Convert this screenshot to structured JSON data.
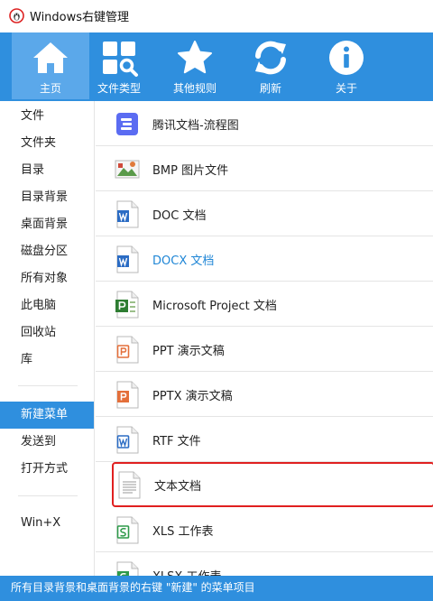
{
  "window": {
    "title": "Windows右键管理",
    "app_icon": "app-logo-icon"
  },
  "toolbar": {
    "buttons": [
      {
        "label": "主页",
        "icon": "home-icon",
        "active": true
      },
      {
        "label": "文件类型",
        "icon": "file-types-icon",
        "active": false
      },
      {
        "label": "其他规则",
        "icon": "star-icon",
        "active": false
      },
      {
        "label": "刷新",
        "icon": "refresh-icon",
        "active": false
      },
      {
        "label": "关于",
        "icon": "info-icon",
        "active": false
      }
    ]
  },
  "sidebar": {
    "items": [
      {
        "label": "文件"
      },
      {
        "label": "文件夹"
      },
      {
        "label": "目录"
      },
      {
        "label": "目录背景"
      },
      {
        "label": "桌面背景"
      },
      {
        "label": "磁盘分区"
      },
      {
        "label": "所有对象"
      },
      {
        "label": "此电脑"
      },
      {
        "label": "回收站"
      },
      {
        "label": "库"
      },
      {
        "label": "新建菜单",
        "active": true
      },
      {
        "label": "发送到"
      },
      {
        "label": "打开方式"
      },
      {
        "label": "Win+X"
      }
    ]
  },
  "list": {
    "items": [
      {
        "label": "腾讯文档-流程图",
        "icon": "tencent-flowchart-icon"
      },
      {
        "label": "BMP 图片文件",
        "icon": "bmp-image-icon"
      },
      {
        "label": "DOC 文档",
        "icon": "word-doc-icon"
      },
      {
        "label": "DOCX 文档",
        "icon": "word-docx-icon",
        "selected": true
      },
      {
        "label": "Microsoft Project 文档",
        "icon": "project-file-icon"
      },
      {
        "label": "PPT 演示文稿",
        "icon": "ppt-file-icon"
      },
      {
        "label": "PPTX 演示文稿",
        "icon": "pptx-file-icon"
      },
      {
        "label": "RTF 文件",
        "icon": "rtf-file-icon"
      },
      {
        "label": "文本文档",
        "icon": "text-file-icon",
        "highlighted": true
      },
      {
        "label": "XLS 工作表",
        "icon": "xls-file-icon"
      },
      {
        "label": "XLSX 工作表",
        "icon": "xlsx-file-icon"
      }
    ]
  },
  "status": {
    "text": "所有目录背景和桌面背景的右键 \"新建\" 的菜单项目"
  },
  "colors": {
    "accent": "#2f8fde",
    "active_tab": "#5ba8ea",
    "highlight_border": "#e02020",
    "selected_text": "#1f86d6"
  }
}
